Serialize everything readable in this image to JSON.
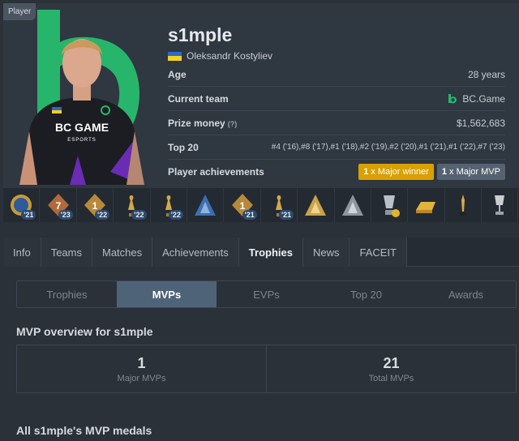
{
  "player_tag": "Player",
  "player": {
    "nickname": "s1mple",
    "full_name": "Oleksandr Kostyliev",
    "age_label": "Age",
    "age": "28 years",
    "team_label": "Current team",
    "team": "BC.Game",
    "prize_label": "Prize money",
    "prize_hint": "(?)",
    "prize": "$1,562,683",
    "top20_label": "Top 20",
    "top20": "#4 ('16),#8 ('17),#1 ('18),#2 ('19),#2 ('20),#1 ('21),#1 ('22),#7 ('23)",
    "achievements_label": "Player achievements",
    "major_winner_count": "1",
    "major_winner_label": "x Major winner",
    "major_mvp_count": "1",
    "major_mvp_label": "x Major MVP"
  },
  "trophies": [
    {
      "icon": "blue-medal-icon",
      "year": "'21"
    },
    {
      "icon": "bronze-rank-7-icon",
      "year": "'23",
      "rank": "7"
    },
    {
      "icon": "gold-rank-1-icon",
      "year": "'22",
      "rank": "1"
    },
    {
      "icon": "trophy-figure-icon",
      "year": "'22"
    },
    {
      "icon": "trophy-figure-icon",
      "year": "'22"
    },
    {
      "icon": "blue-triangle-trophy-icon",
      "year": ""
    },
    {
      "icon": "gold-rank-1-icon",
      "year": "'21",
      "rank": "1"
    },
    {
      "icon": "trophy-figure-icon",
      "year": "'21"
    },
    {
      "icon": "gold-triangle-trophy-icon",
      "year": ""
    },
    {
      "icon": "silver-triangle-trophy-icon",
      "year": ""
    },
    {
      "icon": "major-trophy-star-icon",
      "year": ""
    },
    {
      "icon": "gold-bar-icon",
      "year": ""
    },
    {
      "icon": "gold-statue-icon",
      "year": ""
    },
    {
      "icon": "silver-cup-icon",
      "year": ""
    }
  ],
  "tabs": [
    "Info",
    "Teams",
    "Matches",
    "Achievements",
    "Trophies",
    "News",
    "FACEIT"
  ],
  "active_tab": "Trophies",
  "subtabs": [
    "Trophies",
    "MVPs",
    "EVPs",
    "Top 20",
    "Awards"
  ],
  "active_subtab": "MVPs",
  "mvp_overview": {
    "title": "MVP overview for s1mple",
    "major_mvps_value": "1",
    "major_mvps_label": "Major MVPs",
    "total_mvps_value": "21",
    "total_mvps_label": "Total MVPs"
  },
  "medals_title": "All s1mple's MVP medals",
  "colors": {
    "accent": "#4f6378",
    "gold_badge": "#d9a000",
    "brand_green": "#27b56b"
  }
}
